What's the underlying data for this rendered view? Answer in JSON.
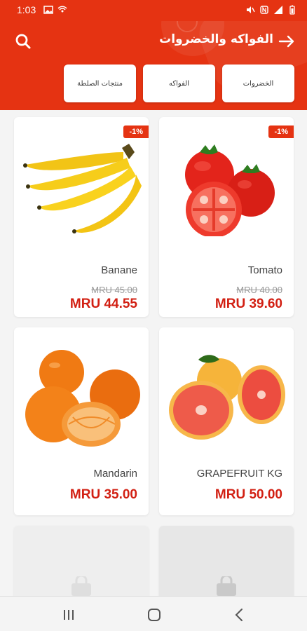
{
  "status": {
    "time": "1:03"
  },
  "header": {
    "title": "الفواكه والخضروات"
  },
  "categories": [
    {
      "label": "الخضروات"
    },
    {
      "label": "الفواكه"
    },
    {
      "label": "منتجات الصلطة"
    }
  ],
  "products": [
    {
      "name": "Tomato",
      "discount": "-1%",
      "old_price": "MRU 40.00",
      "price": "MRU 39.60",
      "image": "tomato"
    },
    {
      "name": "Banane",
      "discount": "-1%",
      "old_price": "MRU 45.00",
      "price": "MRU 44.55",
      "image": "banana"
    },
    {
      "name": "GRAPEFRUIT KG",
      "price": "MRU 50.00",
      "image": "grapefruit"
    },
    {
      "name": "Mandarin",
      "price": "MRU 35.00",
      "image": "mandarin"
    }
  ],
  "icons": {
    "search": "search-icon",
    "back": "arrow-right-icon",
    "nav": [
      "recent-apps-icon",
      "home-icon",
      "back-icon"
    ]
  },
  "colors": {
    "accent": "#e53312",
    "price": "#d21f12"
  }
}
